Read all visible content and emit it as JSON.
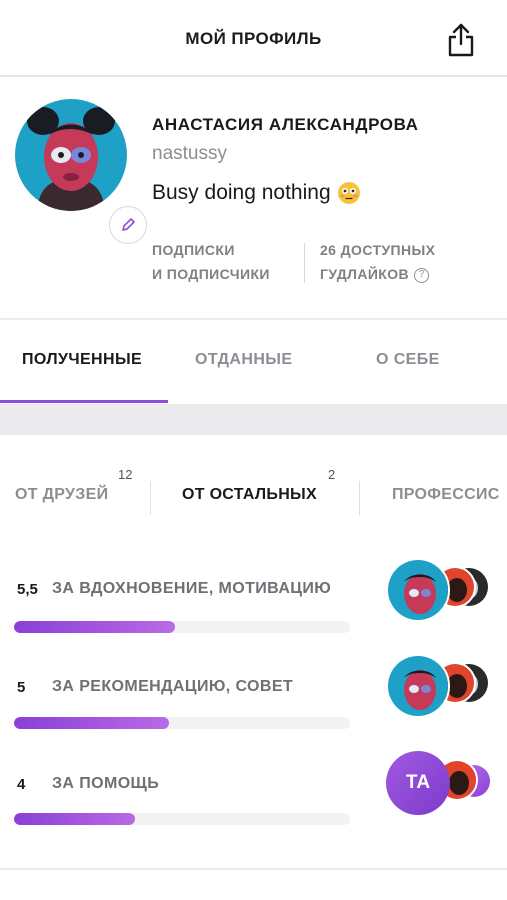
{
  "header": {
    "title": "МОЙ ПРОФИЛЬ"
  },
  "profile": {
    "name": "АНАСТАСИЯ АЛЕКСАНДРОВА",
    "username": "nastussy",
    "status": "Busy doing nothing",
    "stats": {
      "subscriptions_line1": "ПОДПИСКИ",
      "subscriptions_line2": "И ПОДПИСЧИКИ",
      "available_line1": "26 ДОСТУПНЫХ",
      "available_line2": "ГУДЛАЙКОВ",
      "help": "?"
    }
  },
  "tabs": [
    {
      "label": "ПОЛУЧЕННЫЕ",
      "active": true
    },
    {
      "label": "ОТДАННЫЕ",
      "active": false
    },
    {
      "label": "О СЕБЕ",
      "active": false
    }
  ],
  "subtabs": [
    {
      "label": "ОТ ДРУЗЕЙ",
      "count": "12",
      "active": false
    },
    {
      "label": "ОТ ОСТАЛЬНЫХ",
      "count": "2",
      "active": true
    },
    {
      "label": "ПРОФЕССИС",
      "count": "",
      "active": false
    }
  ],
  "categories": [
    {
      "value": "5,5",
      "label": "ЗА ВДОХНОВЕНИЕ, МОТИВАЦИЮ",
      "progress": 0.48
    },
    {
      "value": "5",
      "label": "ЗА РЕКОМЕНДАЦИЮ, СОВЕТ",
      "progress": 0.46
    },
    {
      "value": "4",
      "label": "ЗА ПОМОЩЬ",
      "progress": 0.36,
      "initials": "ТА"
    }
  ],
  "colors": {
    "accent": "#8e4fd8",
    "bar_gradient_start": "#8a3fd8",
    "bar_gradient_end": "#b96ae6"
  }
}
